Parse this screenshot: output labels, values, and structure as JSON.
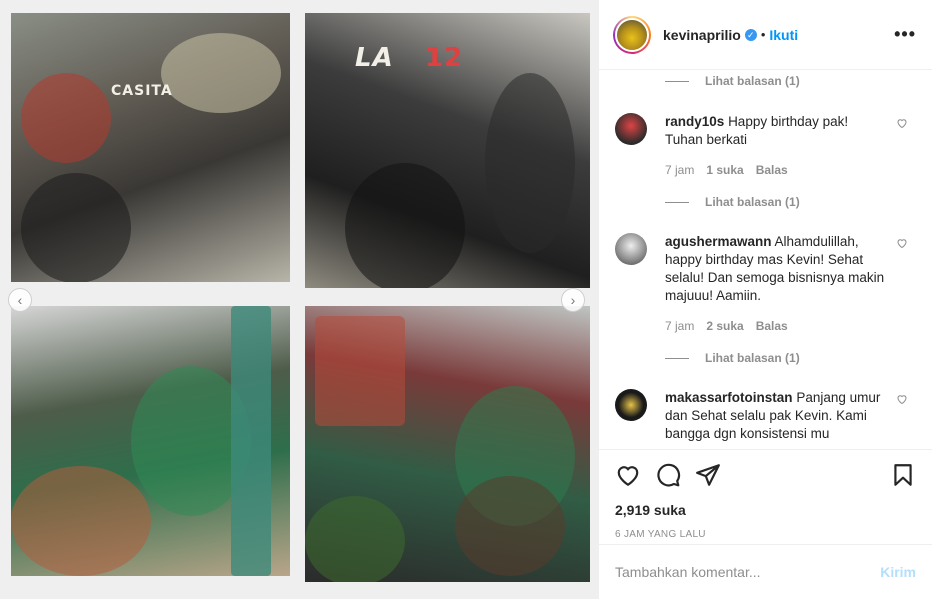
{
  "post": {
    "username": "kevinaprilio",
    "verified_icon": "verified-badge-icon",
    "follow_label": "Ikuti",
    "separator": "•",
    "more_label": "•••"
  },
  "media": {
    "sign_text_1": "CASITA",
    "sign_text_2": "LA",
    "sign_text_3": "12",
    "prev_label": "‹",
    "next_label": "›"
  },
  "comments": {
    "view_replies_1": "Lihat balasan (1)",
    "items": [
      {
        "username": "randy10s",
        "text": "Happy birthday pak! Tuhan berkati",
        "time": "7 jam",
        "likes": "1 suka",
        "reply": "Balas",
        "view_replies": "Lihat balasan (1)"
      },
      {
        "username": "agushermawann",
        "text": "Alhamdulillah, happy birthday mas Kevin! Sehat selalu! Dan semoga bisnisnya makin majuuu! Aamiin.",
        "time": "7 jam",
        "likes": "2 suka",
        "reply": "Balas",
        "view_replies": "Lihat balasan (1)"
      },
      {
        "username": "makassarfotoinstan",
        "text": "Panjang umur dan Sehat selalu pak Kevin. Kami bangga dgn konsistensi mu"
      }
    ]
  },
  "actions": {
    "likes_count": "2,919 suka",
    "timestamp": "6 JAM YANG LALU"
  },
  "composer": {
    "placeholder": "Tambahkan komentar...",
    "post_label": "Kirim"
  },
  "colors": {
    "accent": "#0095f6",
    "muted": "#8e8e8e",
    "post_disabled": "#b2dffc"
  }
}
